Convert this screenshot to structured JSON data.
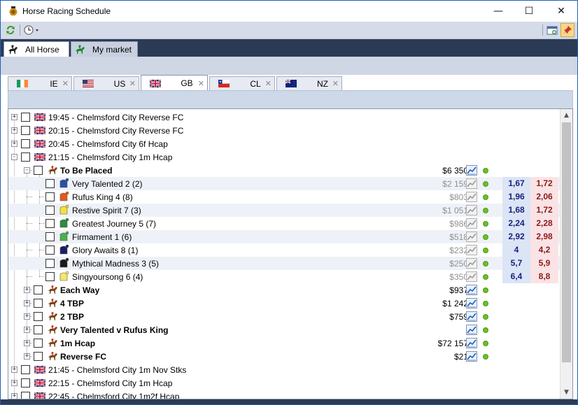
{
  "window": {
    "title": "Horse Racing Schedule",
    "minimize": "—",
    "maximize": "☐",
    "close": "✕"
  },
  "main_tabs": [
    {
      "label": "All Horse",
      "active": true
    },
    {
      "label": "My market",
      "active": false
    }
  ],
  "country_tabs": [
    {
      "label": "IE",
      "active": false
    },
    {
      "label": "US",
      "active": false
    },
    {
      "label": "GB",
      "active": true
    },
    {
      "label": "CL",
      "active": false
    },
    {
      "label": "NZ",
      "active": false
    }
  ],
  "races_before": [
    {
      "label": "19:45 - Chelmsford City Reverse FC"
    },
    {
      "label": "20:15 - Chelmsford City Reverse FC"
    },
    {
      "label": "20:45 - Chelmsford City 6f Hcap"
    },
    {
      "label": "21:15 - Chelmsford City 1m Hcap"
    }
  ],
  "expanded_market": {
    "label": "To Be Placed",
    "amount": "$6 350"
  },
  "runners": [
    {
      "name": "Very Talented 2 (2)",
      "amount": "$2 159",
      "back": "1,67",
      "lay": "1,72",
      "silk": "#2a4fa8"
    },
    {
      "name": "Rufus King 4 (8)",
      "amount": "$803",
      "back": "1,96",
      "lay": "2,06",
      "silk": "#e25a1c"
    },
    {
      "name": "Restive Spirit 7 (3)",
      "amount": "$1 051",
      "back": "1,68",
      "lay": "1,72",
      "silk": "#f2e23a"
    },
    {
      "name": "Greatest Journey 5 (7)",
      "amount": "$986",
      "back": "2,24",
      "lay": "2,28",
      "silk": "#2e8b3e"
    },
    {
      "name": "Firmament 1 (6)",
      "amount": "$518",
      "back": "2,92",
      "lay": "2,98",
      "silk": "#4caf50"
    },
    {
      "name": "Glory Awaits 8 (1)",
      "amount": "$232",
      "back": "4",
      "lay": "4,2",
      "silk": "#1a1f6b"
    },
    {
      "name": "Mythical Madness 3 (5)",
      "amount": "$250",
      "back": "5,7",
      "lay": "5,9",
      "silk": "#1a1a1a"
    },
    {
      "name": "Singyoursong 6 (4)",
      "amount": "$350",
      "back": "6,4",
      "lay": "8,8",
      "silk": "#f5e66a"
    }
  ],
  "other_markets": [
    {
      "label": "Each Way",
      "amount": "$937"
    },
    {
      "label": "4 TBP",
      "amount": "$1 242"
    },
    {
      "label": "2 TBP",
      "amount": "$759"
    },
    {
      "label": "Very Talented v Rufus King",
      "amount": ""
    },
    {
      "label": "1m Hcap",
      "amount": "$72 157"
    },
    {
      "label": "Reverse FC",
      "amount": "$21"
    }
  ],
  "races_after": [
    {
      "label": "21:45 - Chelmsford City 1m Nov Stks"
    },
    {
      "label": "22:15 - Chelmsford City 1m Hcap"
    },
    {
      "label": "22:45 - Chelmsford City 1m2f Hcap"
    }
  ],
  "colors": {
    "back_bg": "#dbe5f6",
    "lay_bg": "#fae3e5",
    "status_dot": "#6cbf2a",
    "header_band": "#2c3b55"
  }
}
